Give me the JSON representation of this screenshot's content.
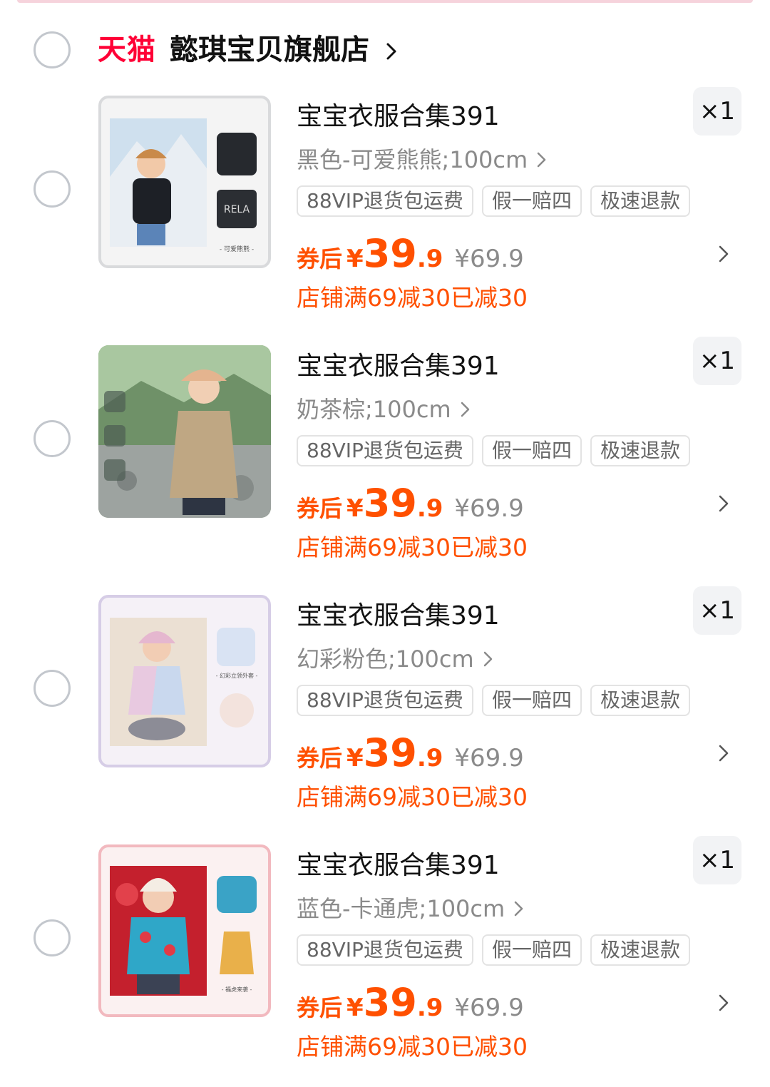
{
  "store": {
    "platform_logo": "天猫",
    "name": "懿琪宝贝旗舰店"
  },
  "items": [
    {
      "title": "宝宝衣服合集391",
      "sku": "黑色-可爱熊熊;100cm",
      "quantity": "×1",
      "tags": [
        "88VIP退货包运费",
        "假一赔四",
        "极速退款"
      ],
      "price_label": "券后",
      "price_symbol": "¥",
      "price_integer": "39",
      "price_decimal": ".9",
      "original_price": "¥69.9",
      "promo": "店铺满69减30已减30",
      "image_caption": "- 可爱熊熊 -"
    },
    {
      "title": "宝宝衣服合集391",
      "sku": "奶茶棕;100cm",
      "quantity": "×1",
      "tags": [
        "88VIP退货包运费",
        "假一赔四",
        "极速退款"
      ],
      "price_label": "券后",
      "price_symbol": "¥",
      "price_integer": "39",
      "price_decimal": ".9",
      "original_price": "¥69.9",
      "promo": "店铺满69减30已减30",
      "image_caption": ""
    },
    {
      "title": "宝宝衣服合集391",
      "sku": "幻彩粉色;100cm",
      "quantity": "×1",
      "tags": [
        "88VIP退货包运费",
        "假一赔四",
        "极速退款"
      ],
      "price_label": "券后",
      "price_symbol": "¥",
      "price_integer": "39",
      "price_decimal": ".9",
      "original_price": "¥69.9",
      "promo": "店铺满69减30已减30",
      "image_caption": "- 幻彩立领外套 -"
    },
    {
      "title": "宝宝衣服合集391",
      "sku": "蓝色-卡通虎;100cm",
      "quantity": "×1",
      "tags": [
        "88VIP退货包运费",
        "假一赔四",
        "极速退款"
      ],
      "price_label": "券后",
      "price_symbol": "¥",
      "price_integer": "39",
      "price_decimal": ".9",
      "original_price": "¥69.9",
      "promo": "店铺满69减30已减30",
      "image_caption": "- 福虎来袭 -"
    }
  ],
  "colors": {
    "accent": "#ff5000",
    "tmall_red": "#ff0036",
    "muted_text": "#8a8a8a"
  }
}
